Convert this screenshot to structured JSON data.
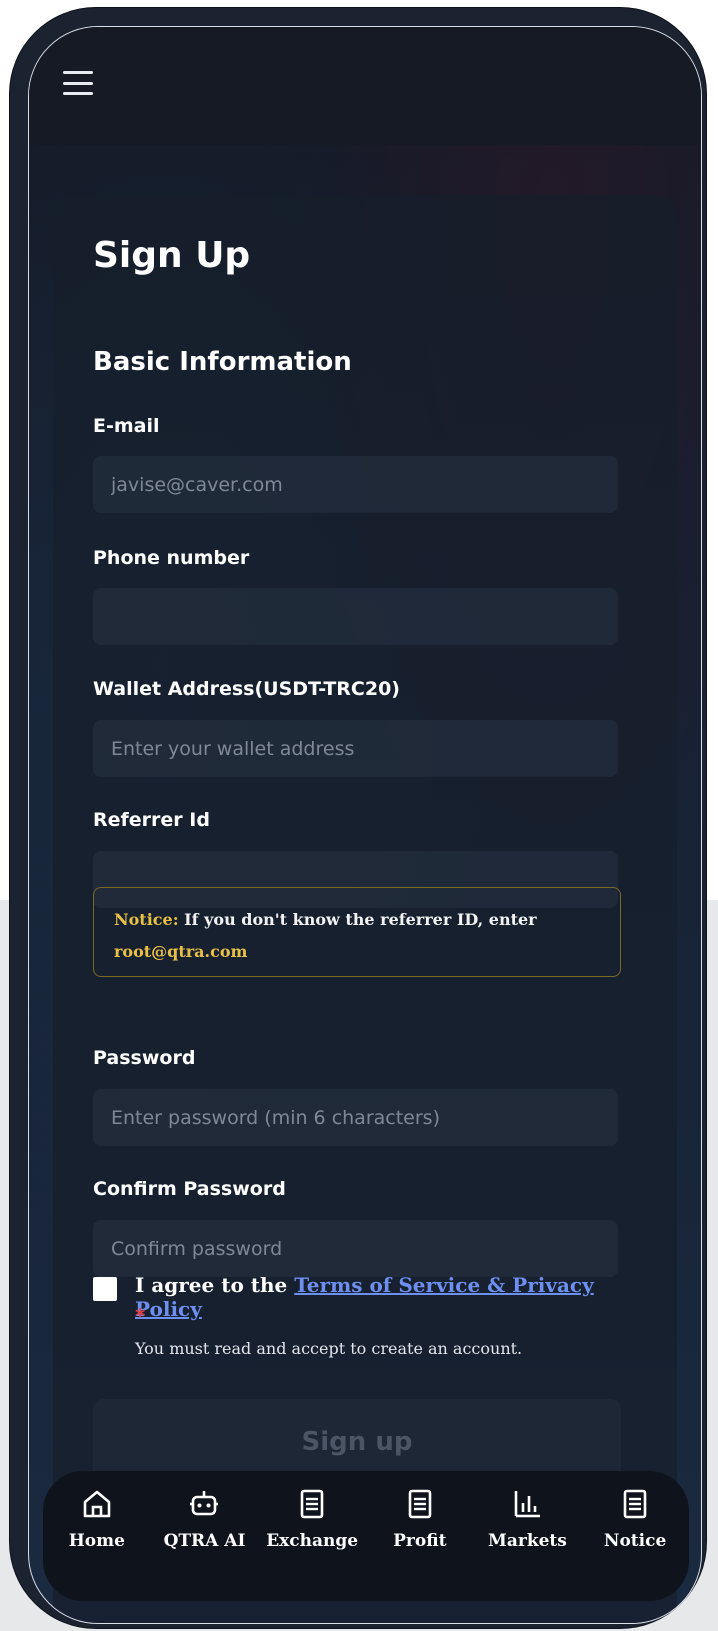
{
  "page": {
    "title": "Sign Up",
    "section_title": "Basic Information"
  },
  "form": {
    "email": {
      "label": "E-mail",
      "value": "",
      "placeholder": "javise@caver.com"
    },
    "phone": {
      "label": "Phone number",
      "value": "",
      "placeholder": ""
    },
    "wallet": {
      "label": "Wallet Address(USDT-TRC20)",
      "value": "",
      "placeholder": "Enter your wallet address"
    },
    "referrer": {
      "label": "Referrer Id",
      "value": "",
      "placeholder": ""
    },
    "notice": {
      "prefix": "Notice:",
      "text": " If you don't know the referrer ID, enter ",
      "email": "root@qtra.com"
    },
    "password": {
      "label": "Password",
      "value": "",
      "placeholder": "Enter password (min 6 characters)"
    },
    "confirm": {
      "label": "Confirm Password",
      "value": "",
      "placeholder": "Confirm password"
    },
    "agree": {
      "prefix": "I agree to the ",
      "link": "Terms of Service & Privacy Policy",
      "required_mark": "*",
      "hint": "You must read and accept to create an account."
    },
    "submit_label": "Sign up"
  },
  "nav": {
    "items": [
      {
        "label": "Home",
        "icon": "home-icon"
      },
      {
        "label": "QTRA AI",
        "icon": "robot-icon"
      },
      {
        "label": "Exchange",
        "icon": "document-icon"
      },
      {
        "label": "Profit",
        "icon": "document-icon"
      },
      {
        "label": "Markets",
        "icon": "bar-chart-icon"
      },
      {
        "label": "Notice",
        "icon": "document-icon"
      }
    ]
  },
  "colors": {
    "accent_link": "#6d8ff0",
    "notice_highlight": "#e9c046",
    "required": "#e03b3b"
  }
}
